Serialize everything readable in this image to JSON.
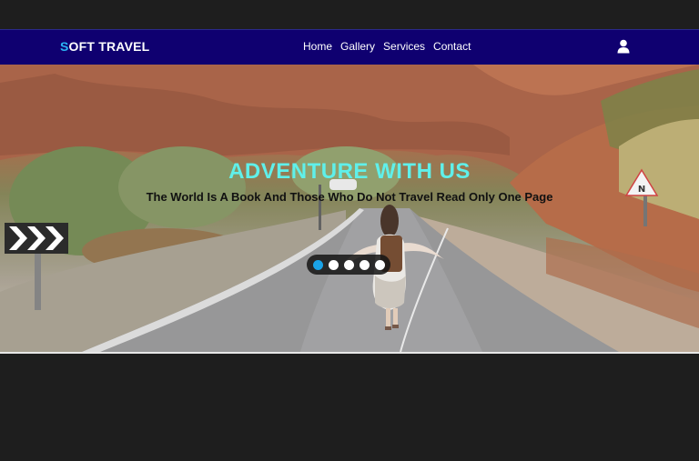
{
  "brand": {
    "first_letter": "S",
    "rest": "OFT TRAVEL",
    "accent_color": "#2bb5f5"
  },
  "nav": {
    "items": [
      {
        "label": "Home"
      },
      {
        "label": "Gallery"
      },
      {
        "label": "Services"
      },
      {
        "label": "Contact"
      }
    ],
    "background": "#0f0070",
    "user_icon": "user-icon"
  },
  "hero": {
    "title": "ADVENTURE WITH US",
    "subtitle": "The World Is A Book And Those Who Do Not Travel Read Only One Page",
    "title_color": "#5ff0ea",
    "carousel": {
      "total_slides": 5,
      "active_index": 0,
      "active_color": "#1aa3e8"
    }
  }
}
